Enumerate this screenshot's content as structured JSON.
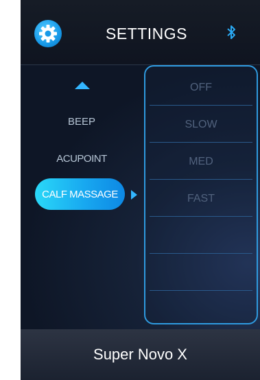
{
  "header": {
    "title": "SETTINGS",
    "settings_icon": "gear-icon",
    "bluetooth_icon": "bluetooth-icon"
  },
  "nav": {
    "up_icon": "up-arrow-icon",
    "items": [
      "BEEP",
      "ACUPOINT",
      "CALF MASSAGE"
    ],
    "selected": "CALF MASSAGE",
    "pointer_icon": "right-arrow-icon"
  },
  "options": {
    "items": [
      "OFF",
      "SLOW",
      "MED",
      "FAST"
    ]
  },
  "footer": {
    "device_name": "Super Novo X"
  },
  "colors": {
    "accent": "#1fa9f2",
    "header_bg": "#131a24",
    "panel_border": "#2f9be0",
    "inactive_text": "#51627d"
  }
}
